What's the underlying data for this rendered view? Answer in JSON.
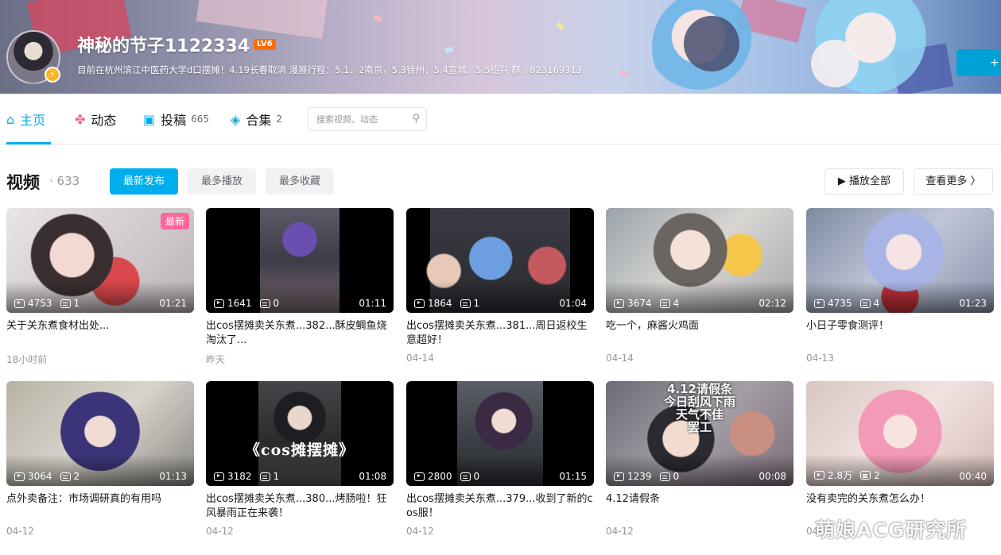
{
  "profile": {
    "name": "神秘的节子1122334",
    "level": "LV6",
    "signature": "目前在杭州滨江中医药大学d口摆摊！4.19长春取消 漫展行程：5.1、2南京，5.3徐州、5.4宣城、5.5绍兴 群：823169313",
    "follow_label": "+"
  },
  "nav": {
    "home": "主页",
    "dynamic": "动态",
    "upload": "投稿",
    "upload_count": "665",
    "collection": "合集",
    "collection_count": "2",
    "search_placeholder": "搜索视频、动态"
  },
  "section": {
    "title": "视频",
    "count": "· 633",
    "tab_new": "最新发布",
    "tab_play": "最多播放",
    "tab_fav": "最多收藏",
    "play_all": "▶ 播放全部",
    "see_more": "查看更多 〉"
  },
  "videos": [
    {
      "title": "关于关东煮食材出处...",
      "plays": "4753",
      "danmaku": "1",
      "duration": "01:21",
      "date": "18小时前",
      "tag": "最新"
    },
    {
      "title": "出cos摆摊卖关东煮...382...酥皮鲷鱼烧淘汰了...",
      "plays": "1641",
      "danmaku": "0",
      "duration": "01:11",
      "date": "昨天"
    },
    {
      "title": "出cos摆摊卖关东煮...381...周日返校生意超好！",
      "plays": "1864",
      "danmaku": "1",
      "duration": "01:04",
      "date": "04-14"
    },
    {
      "title": "吃一个，麻酱火鸡面",
      "plays": "3674",
      "danmaku": "4",
      "duration": "02:12",
      "date": "04-14"
    },
    {
      "title": "小日子零食测评！",
      "plays": "4735",
      "danmaku": "4",
      "duration": "01:23",
      "date": "04-13"
    },
    {
      "title": "点外卖备注：市场调研真的有用吗",
      "plays": "3064",
      "danmaku": "2",
      "duration": "01:13",
      "date": "04-12"
    },
    {
      "title": "出cos摆摊卖关东煮...380...烤肠啦！狂风暴雨正在来袭！",
      "plays": "3182",
      "danmaku": "1",
      "duration": "01:08",
      "date": "04-12",
      "overlay": "《cos摊摆摊》"
    },
    {
      "title": "出cos摆摊卖关东煮...379...收到了新的cos服！",
      "plays": "2800",
      "danmaku": "0",
      "duration": "01:15",
      "date": "04-12"
    },
    {
      "title": "4.12请假条",
      "plays": "1239",
      "danmaku": "0",
      "duration": "00:08",
      "date": "04-12",
      "note": "4.12请假条\n今日刮风下雨\n天气不佳\n罢工"
    },
    {
      "title": "没有卖完的关东煮怎么办！",
      "plays": "2.8万",
      "danmaku": "2",
      "duration": "00:40",
      "date": "04-12"
    }
  ],
  "watermark": "萌娘ACG研究所",
  "colors": {
    "accent": "#00aeec",
    "new_tag": "#ff6699",
    "level": "#ff6c00"
  }
}
